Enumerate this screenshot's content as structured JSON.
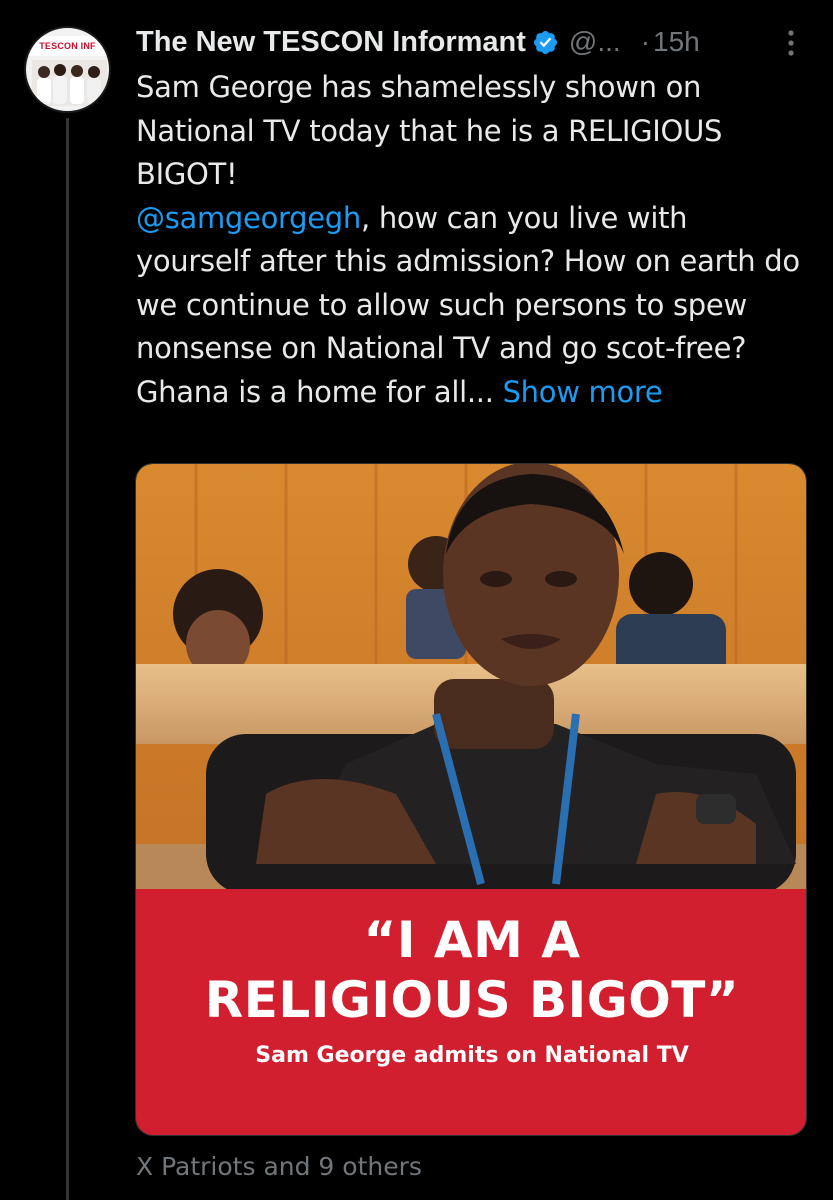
{
  "tweet": {
    "display_name": "The New TESCON Informant",
    "handle": "@...",
    "separator": "·",
    "time": "15h",
    "text": {
      "line1": "Sam George has shamelessly shown on National TV today that he is a RELIGIOUS BIGOT!",
      "mention": "@samgeorgegh",
      "line2": ", how can you live with yourself after this admission? How on earth do we continue to allow such persons to spew nonsense on National TV and go scot-free? Ghana is a home for all... ",
      "show_more": "Show more"
    },
    "avatar": {
      "banner_left": "TESCON",
      "banner_right": "INF"
    },
    "media": {
      "quote_line1": "“I AM A",
      "quote_line2": "RELIGIOUS BIGOT”",
      "subcaption": "Sam George admits on National TV",
      "banner_color": "#d11f2f"
    },
    "social_context": "X Patriots and 9 others",
    "icons": {
      "verified": "verified-badge-icon",
      "more": "more-options-icon"
    }
  },
  "colors": {
    "background": "#000000",
    "text": "#e7e9ea",
    "muted": "#71767b",
    "link": "#1d9bf0",
    "verified": "#1d9bf0"
  }
}
